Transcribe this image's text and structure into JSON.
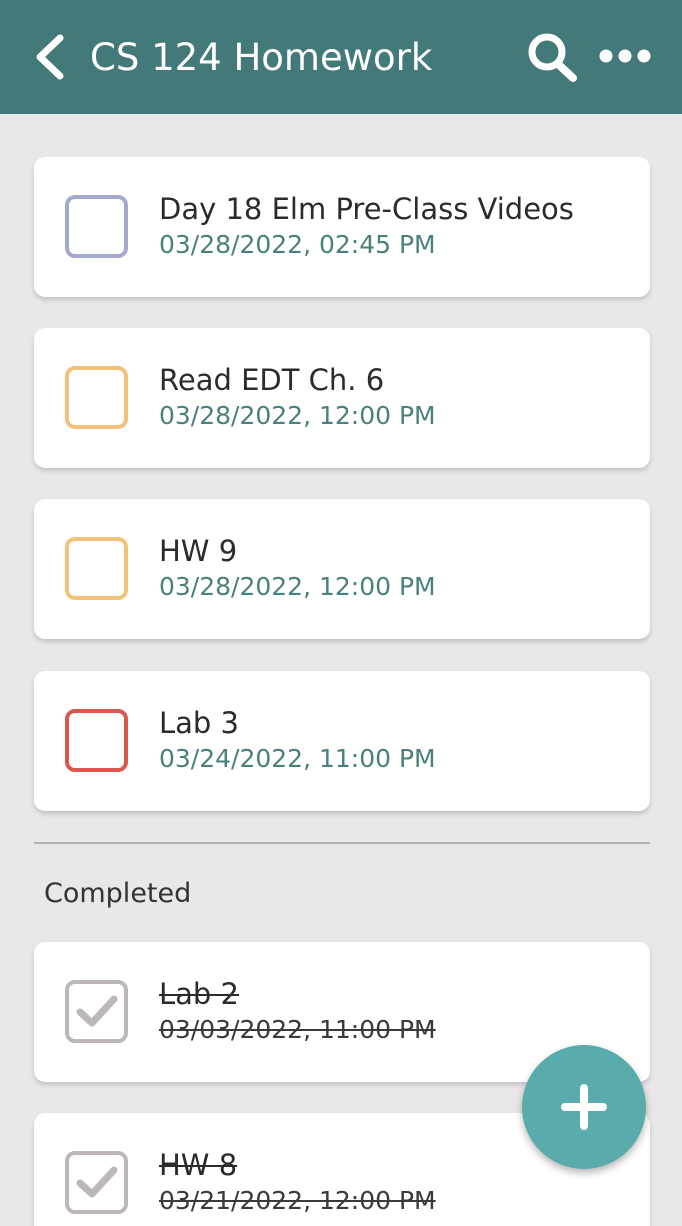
{
  "header": {
    "title": "CS 124 Homework",
    "back_icon": "chevron-left-icon",
    "search_icon": "search-icon",
    "more_icon": "more-horizontal-icon",
    "background": "#437978"
  },
  "tasks": [
    {
      "title": "Day 18 Elm Pre-Class Videos",
      "date": "03/28/2022, 02:45 PM",
      "color": "#a5a9cf",
      "completed": false
    },
    {
      "title": "Read EDT Ch. 6",
      "date": "03/28/2022, 12:00 PM",
      "color": "#f3c27a",
      "completed": false
    },
    {
      "title": "HW 9",
      "date": "03/28/2022, 12:00 PM",
      "color": "#f3c27a",
      "completed": false
    },
    {
      "title": "Lab 3",
      "date": "03/24/2022, 11:00 PM",
      "color": "#d9574d",
      "completed": false
    }
  ],
  "completed_section": {
    "label": "Completed",
    "tasks": [
      {
        "title": "Lab 2",
        "date": "03/03/2022, 11:00 PM",
        "color": "#bdb7b8",
        "completed": true
      },
      {
        "title": "HW 8",
        "date": "03/21/2022, 12:00 PM",
        "color": "#bdb7b8",
        "completed": true
      }
    ]
  },
  "fab": {
    "icon": "plus-icon",
    "color": "#5aabab"
  }
}
